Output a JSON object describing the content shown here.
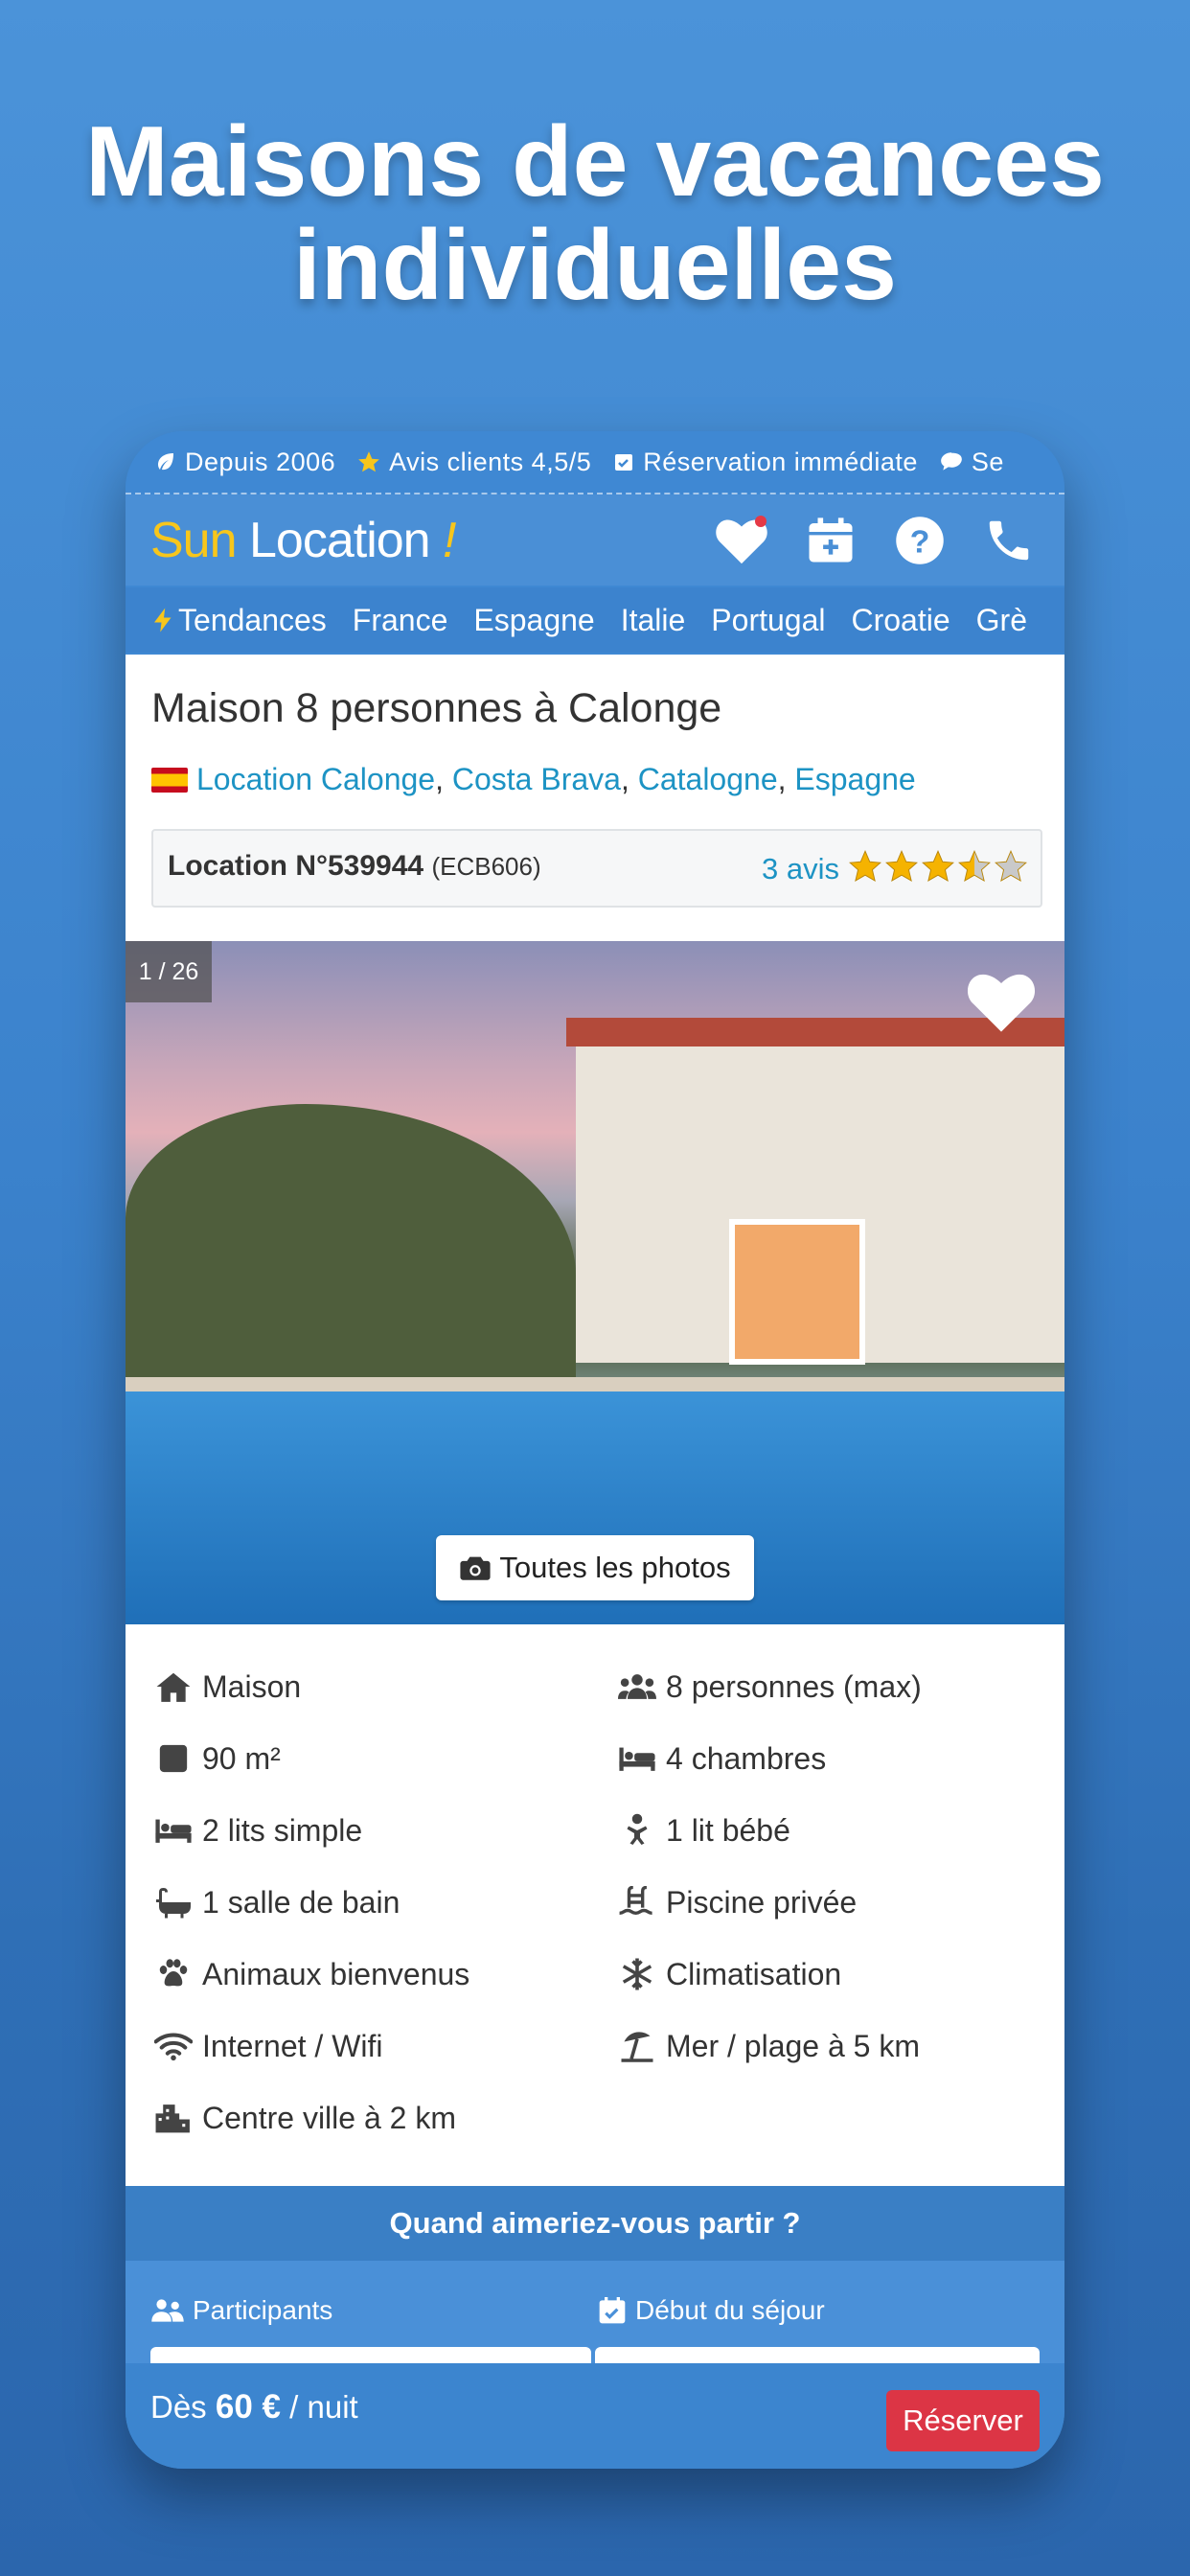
{
  "headline": {
    "line1": "Maisons de vacances",
    "line2": "individuelles"
  },
  "trust_bar": [
    {
      "icon": "leaf-icon",
      "label": "Depuis 2006"
    },
    {
      "icon": "star-icon",
      "label": "Avis clients 4,5/5"
    },
    {
      "icon": "calendar-check-icon",
      "label": "Réservation immédiate"
    },
    {
      "icon": "chat-icon",
      "label": "Se"
    }
  ],
  "header": {
    "logo_sun": "Sun",
    "logo_location": "Location",
    "logo_exclaim": "!",
    "icons": [
      "heart-icon",
      "calendar-plus-icon",
      "help-icon",
      "phone-icon"
    ]
  },
  "nav": {
    "items": [
      "Tendances",
      "France",
      "Espagne",
      "Italie",
      "Portugal",
      "Croatie",
      "Grè"
    ]
  },
  "listing": {
    "title": "Maison 8 personnes à Calonge",
    "location_links": [
      "Location Calonge",
      "Costa Brava",
      "Catalogne",
      "Espagne"
    ],
    "ref_label": "Location N°539944",
    "ref_code": "(ECB606)",
    "reviews_label": "3 avis",
    "rating": 3.5,
    "rating_max": 5
  },
  "photo": {
    "counter": "1 / 26",
    "all_photos_label": "Toutes les photos"
  },
  "features": [
    {
      "icon": "home-icon",
      "label": "Maison"
    },
    {
      "icon": "users-icon",
      "label": "8 personnes (max)"
    },
    {
      "icon": "area-icon",
      "label": "90 m²"
    },
    {
      "icon": "bed-icon",
      "label": "4 chambres"
    },
    {
      "icon": "single-bed-icon",
      "label": "2 lits simple"
    },
    {
      "icon": "baby-icon",
      "label": "1 lit bébé"
    },
    {
      "icon": "bath-icon",
      "label": "1 salle de bain"
    },
    {
      "icon": "pool-icon",
      "label": "Piscine privée"
    },
    {
      "icon": "paw-icon",
      "label": "Animaux bienvenus"
    },
    {
      "icon": "snowflake-icon",
      "label": "Climatisation"
    },
    {
      "icon": "wifi-icon",
      "label": "Internet / Wifi"
    },
    {
      "icon": "umbrella-beach-icon",
      "label": "Mer / plage à 5 km"
    },
    {
      "icon": "city-icon",
      "label": "Centre ville à 2 km"
    }
  ],
  "booking": {
    "heading": "Quand aimeriez-vous partir ?",
    "participants_label": "Participants",
    "start_label": "Début du séjour"
  },
  "bottom_bar": {
    "price_prefix": "Dès",
    "price_value": "60 €",
    "price_suffix": "/ nuit",
    "reserve_label": "Réserver"
  },
  "colors": {
    "primary_blue": "#3f88d3",
    "link_blue": "#1d93c4",
    "logo_yellow": "#f7c61c",
    "reserve_red": "#dc3545",
    "star_gold": "#f5b301"
  }
}
